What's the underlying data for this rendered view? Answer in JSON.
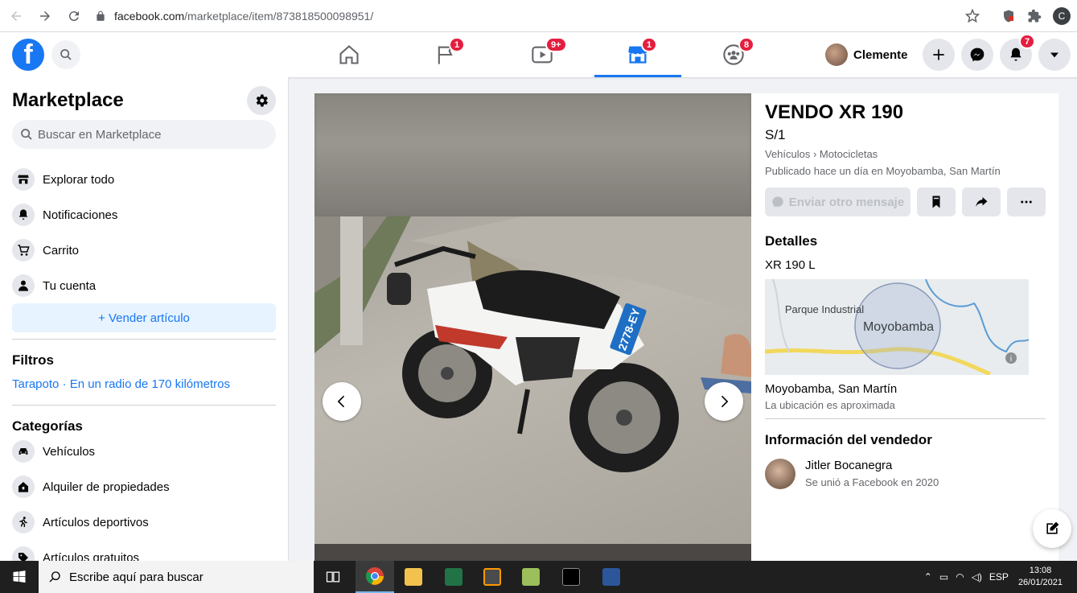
{
  "browser": {
    "url_host": "facebook.com",
    "url_path": "/marketplace/item/873818500098951/",
    "profile_letter": "C"
  },
  "header": {
    "tabs": [
      {
        "name": "home",
        "badge": ""
      },
      {
        "name": "pages",
        "badge": "1"
      },
      {
        "name": "watch",
        "badge": "9+"
      },
      {
        "name": "marketplace",
        "badge": "1"
      },
      {
        "name": "groups",
        "badge": "8"
      }
    ],
    "profile_name": "Clemente",
    "notifications_badge": "7"
  },
  "sidebar": {
    "title": "Marketplace",
    "search_placeholder": "Buscar en Marketplace",
    "items": [
      {
        "label": "Explorar todo",
        "icon": "storefront-icon"
      },
      {
        "label": "Notificaciones",
        "icon": "bell-icon"
      },
      {
        "label": "Carrito",
        "icon": "cart-icon"
      },
      {
        "label": "Tu cuenta",
        "icon": "person-icon"
      }
    ],
    "sell_label": "+ Vender artículo",
    "filters_heading": "Filtros",
    "filters_location": "Tarapoto · En un radio de 170 kilómetros",
    "categories_heading": "Categorías",
    "categories": [
      {
        "label": "Vehículos",
        "icon": "car-icon"
      },
      {
        "label": "Alquiler de propiedades",
        "icon": "house-icon"
      },
      {
        "label": "Artículos deportivos",
        "icon": "runner-icon"
      },
      {
        "label": "Artículos gratuitos",
        "icon": "tag-icon"
      }
    ]
  },
  "listing": {
    "title": "VENDO XR 190",
    "price": "S/1",
    "category_path": "Vehículos › Motocicletas",
    "posted": "Publicado hace un día en Moyobamba, San Martín",
    "message_button": "Enviar otro mensaje",
    "details_heading": "Detalles",
    "details_text": "XR 190 L",
    "map_labels": {
      "area": "Parque Industrial",
      "city": "Moyobamba"
    },
    "location": "Moyobamba, San Martín",
    "location_note": "La ubicación es aproximada",
    "seller_heading": "Información del vendedor",
    "seller_name": "Jitler Bocanegra",
    "seller_joined": "Se unió a Facebook en 2020",
    "plate_text": "2778-EY"
  },
  "taskbar": {
    "search_placeholder": "Escribe aquí para buscar",
    "language": "ESP",
    "time": "13:08",
    "date": "26/01/2021"
  },
  "colors": {
    "fb_blue": "#1877f2",
    "badge_red": "#e41e3f"
  }
}
